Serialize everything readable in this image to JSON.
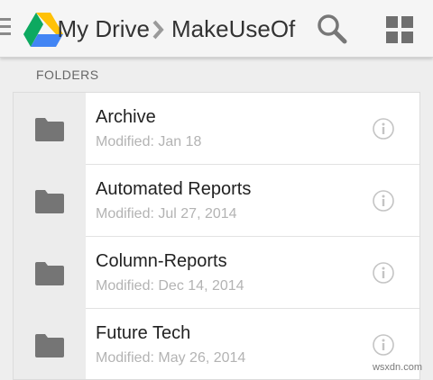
{
  "header": {
    "breadcrumb_parent": "My Drive",
    "breadcrumb_current": "MakeUseOf",
    "icons": {
      "menu": "hamburger-menu-icon",
      "logo": "google-drive-logo",
      "separator": "chevron-right-icon",
      "search": "search-icon",
      "view": "grid-view-icon"
    }
  },
  "section": {
    "title": "FOLDERS"
  },
  "folders": [
    {
      "name": "Archive",
      "modified": "Modified: Jan 18"
    },
    {
      "name": "Automated Reports",
      "modified": "Modified: Jul 27, 2014"
    },
    {
      "name": "Column-Reports",
      "modified": "Modified: Dec 14, 2014"
    },
    {
      "name": "Future Tech",
      "modified": "Modified: May 26, 2014"
    }
  ],
  "watermark": "wsxdn.com",
  "colors": {
    "folder": "#757575",
    "drive_green": "#0DA960",
    "drive_yellow": "#FFC107",
    "drive_blue": "#4285F4"
  }
}
